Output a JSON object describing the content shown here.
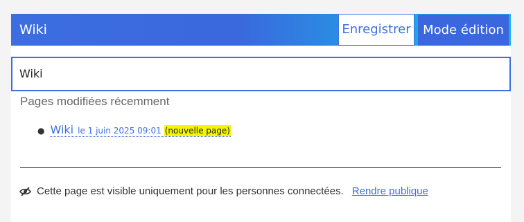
{
  "header": {
    "title": "Wiki",
    "save_label": "Enregistrer",
    "edit_mode_label": "Mode édition"
  },
  "page_title_input": {
    "value": "Wiki"
  },
  "recent_changes": {
    "heading": "Pages modifiées récemment",
    "items": [
      {
        "page": "Wiki",
        "date": "le 1 juin 2025 09:01",
        "badge": "(nouvelle page)"
      }
    ]
  },
  "visibility": {
    "message": "Cette page est visible uniquement pour les personnes connectées.",
    "action_label": "Rendre publique",
    "icon": "eye-slash-icon"
  },
  "colors": {
    "accent": "#3c6ee0",
    "gradient_end": "#1fb0e8",
    "badge_highlight": "#f6f600"
  }
}
